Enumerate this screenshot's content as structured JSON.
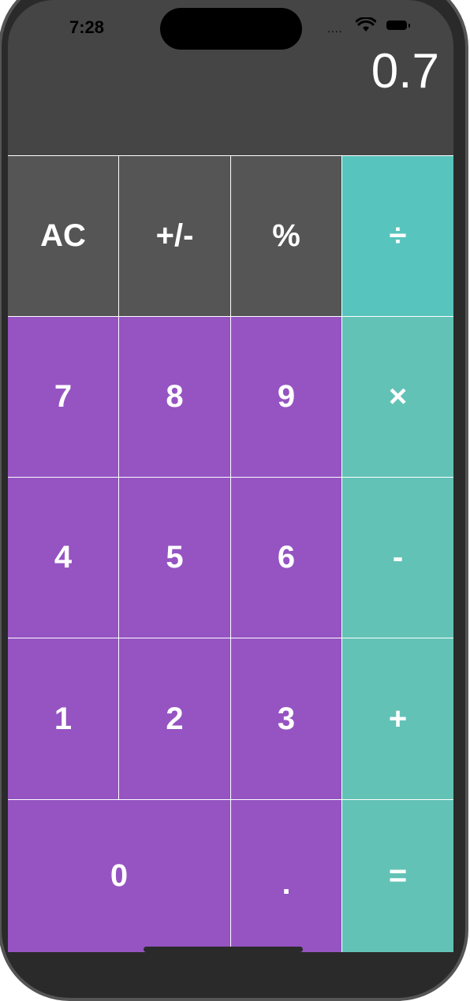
{
  "status_bar": {
    "time": "7:28",
    "signal": "....",
    "wifi_icon": "wifi-icon",
    "battery_icon": "battery-icon"
  },
  "display": {
    "value": "0.7"
  },
  "keys": {
    "ac": "AC",
    "plus_minus": "+/-",
    "percent": "%",
    "divide": "÷",
    "seven": "7",
    "eight": "8",
    "nine": "9",
    "multiply": "×",
    "four": "4",
    "five": "5",
    "six": "6",
    "minus": "-",
    "one": "1",
    "two": "2",
    "three": "3",
    "plus": "+",
    "zero": "0",
    "decimal": ".",
    "equals": "="
  },
  "colors": {
    "display_bg": "#454545",
    "function_key": "#555555",
    "number_key": "#9554c2",
    "operator_key": "#63c2b6",
    "divide_key": "#58c4be"
  }
}
